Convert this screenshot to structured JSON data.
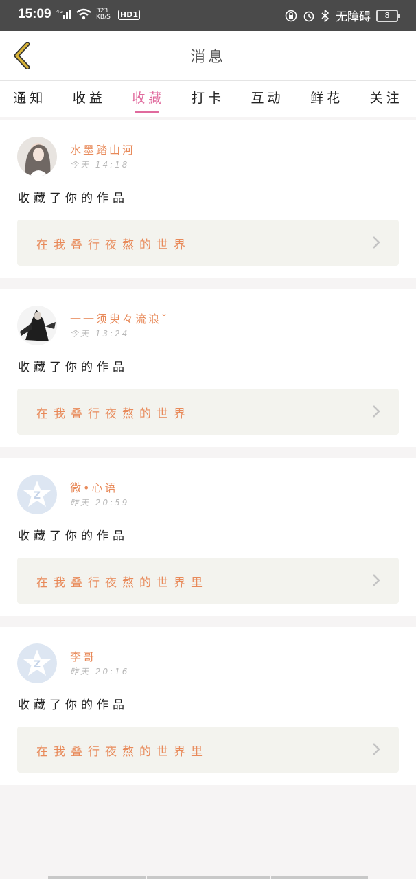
{
  "status_bar": {
    "time": "15:09",
    "net_type": "4G",
    "speed": "323 KB/S",
    "hd": "HD1",
    "accessibility": "无障碍",
    "battery": "8"
  },
  "nav": {
    "title": "消息"
  },
  "tabs": [
    "通知",
    "收益",
    "收藏",
    "打卡",
    "互动",
    "鲜花",
    "关注"
  ],
  "active_tab_index": 2,
  "messages": [
    {
      "user": "水墨踏山河",
      "time": "今天 14:18",
      "action": "收藏了你的作品",
      "work": "在我叠行夜熬的世界",
      "avatar": "ink-portrait"
    },
    {
      "user": "一一须臾々流浪ˇ",
      "time": "今天 13:24",
      "action": "收藏了你的作品",
      "work": "在我叠行夜熬的世界",
      "avatar": "dark-figure"
    },
    {
      "user": "微•心语",
      "time": "昨天 20:59",
      "action": "收藏了你的作品",
      "work": "在我叠行夜熬的世界里",
      "avatar": "default-qq-star"
    },
    {
      "user": "李哥",
      "time": "昨天 20:16",
      "action": "收藏了你的作品",
      "work": "在我叠行夜熬的世界里",
      "avatar": "default-qq-star"
    }
  ],
  "colors": {
    "accent": "#e06a9d",
    "name": "#e88a5a",
    "back": "#d8b338"
  }
}
